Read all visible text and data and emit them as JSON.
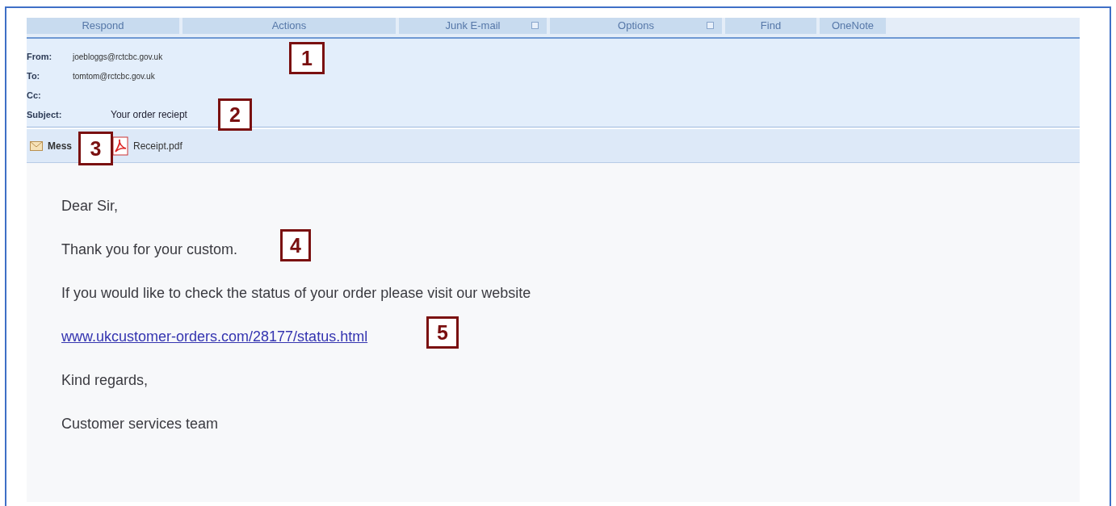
{
  "ribbon_groups": [
    {
      "label": "Respond",
      "launcher": false
    },
    {
      "label": "Actions",
      "launcher": false
    },
    {
      "label": "Junk E-mail",
      "launcher": true
    },
    {
      "label": "Options",
      "launcher": true
    },
    {
      "label": "Find",
      "launcher": false
    },
    {
      "label": "OneNote",
      "launcher": false
    }
  ],
  "header_fields": [
    {
      "label": "From:",
      "value": "joebloggs@rctcbc.gov.uk"
    },
    {
      "label": "To:",
      "value": "tomtom@rctcbc.gov.uk"
    },
    {
      "label": "Cc:"
    },
    {
      "label": "Subject:",
      "value": "Your order reciept",
      "kind": "subject"
    }
  ],
  "attachments": [
    {
      "label": "Mess",
      "kind": "message"
    },
    {
      "label": "Receipt.pdf",
      "kind": "pdf"
    }
  ],
  "body": [
    {
      "kind": "text",
      "text": "Dear Sir,"
    },
    {
      "kind": "text",
      "text": "Thank you for your custom."
    },
    {
      "kind": "text",
      "text": "If you would like to check the status of your order please visit our website"
    },
    {
      "kind": "link",
      "text": "www.ukcustomer-orders.com/28177/status.html"
    },
    {
      "kind": "text",
      "text": "Kind regards,"
    },
    {
      "kind": "text",
      "text": "Customer services team"
    }
  ],
  "callouts": [
    "1",
    "2",
    "3",
    "4",
    "5"
  ]
}
